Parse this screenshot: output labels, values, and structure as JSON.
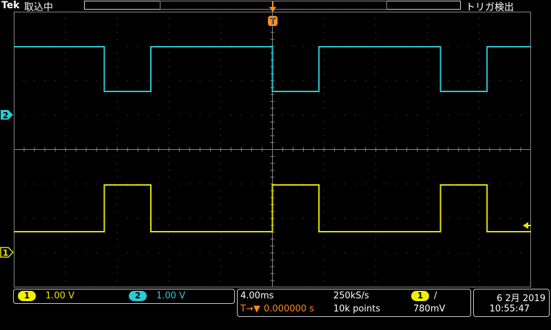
{
  "header": {
    "brand": "Tek",
    "acquisition_status": "取込中",
    "trigger_status": "トリガ検出"
  },
  "markers": {
    "trigger_position": "T",
    "ch2_ground": "2",
    "ch1_ground": "1"
  },
  "channels": [
    {
      "id": "1",
      "scale": "1.00 V",
      "color": "#f2f000"
    },
    {
      "id": "2",
      "scale": "1.00 V",
      "color": "#2ccad6"
    }
  ],
  "timebase": {
    "scale": "4.00ms",
    "sample_rate": "250kS/s",
    "record_length": "10k points",
    "trigger_position_prefix": "T→▼",
    "trigger_delay": "0.000000 s"
  },
  "trigger": {
    "source": "1",
    "slope_symbol": "/",
    "level": "780mV"
  },
  "datetime": {
    "date": "6 2月 2019",
    "time": "10:55:47"
  },
  "colors": {
    "ch1": "#f2f000",
    "ch2": "#2ccad6",
    "trigger": "#ff8c1a",
    "grid": "#8a8a8a"
  }
}
